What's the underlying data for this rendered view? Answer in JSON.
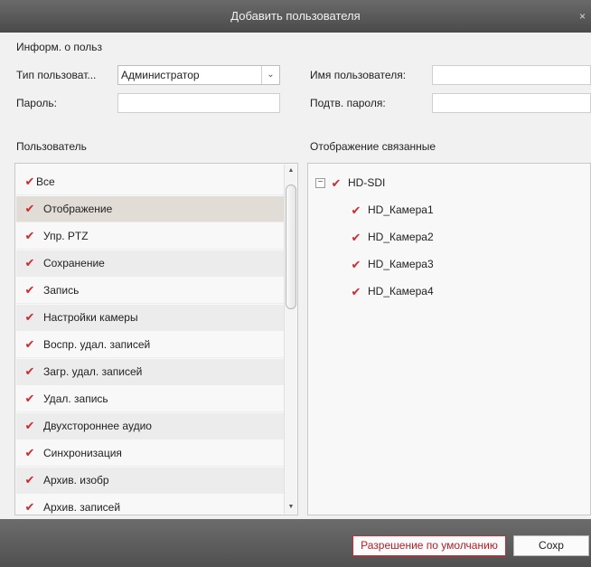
{
  "dialog": {
    "title": "Добавить пользователя",
    "close_glyph": "×"
  },
  "info_section": {
    "label": "Информ. о польз"
  },
  "form": {
    "user_type_label": "Тип пользоват...",
    "user_type_value": "Администратор",
    "user_type_arrow": "⌄",
    "username_label": "Имя пользователя:",
    "username_value": "",
    "password_label": "Пароль:",
    "password_value": "",
    "confirm_label": "Подтв. пароля:",
    "confirm_value": ""
  },
  "permissions": {
    "header": "Пользователь",
    "items": [
      {
        "label": "Все",
        "checked": true
      },
      {
        "label": "Отображение",
        "checked": true
      },
      {
        "label": "Упр. PTZ",
        "checked": true
      },
      {
        "label": "Сохранение",
        "checked": true
      },
      {
        "label": "Запись",
        "checked": true
      },
      {
        "label": "Настройки камеры",
        "checked": true
      },
      {
        "label": "Воспр. удал. записей",
        "checked": true
      },
      {
        "label": "Загр. удал. записей",
        "checked": true
      },
      {
        "label": "Удал. запись",
        "checked": true
      },
      {
        "label": "Двухстороннее аудио",
        "checked": true
      },
      {
        "label": "Синхронизация",
        "checked": true
      },
      {
        "label": "Архив. изобр",
        "checked": true
      },
      {
        "label": "Архив. записей",
        "checked": true
      }
    ],
    "selected_index": 1
  },
  "resources": {
    "header": "Отображение связанные",
    "root": {
      "label": "HD-SDI",
      "checked": true,
      "expander": "−"
    },
    "children": [
      {
        "label": "HD_Камера1",
        "checked": true
      },
      {
        "label": "HD_Камера2",
        "checked": true
      },
      {
        "label": "HD_Камера3",
        "checked": true
      },
      {
        "label": "HD_Камера4",
        "checked": true
      }
    ]
  },
  "glyphs": {
    "check": "✔",
    "scroll_up": "▲",
    "scroll_down": "▼"
  },
  "icons": {
    "check": "checkmark-icon",
    "close": "close-icon",
    "dropdown": "chevron-down-icon",
    "collapse": "minus-icon"
  },
  "colors": {
    "check": "#d0282f",
    "default_button_border": "#d7262d",
    "titlebar": "#5a5a5a"
  },
  "buttons": {
    "default_permission": "Разрешение по умолчанию",
    "save": "Сохр"
  }
}
